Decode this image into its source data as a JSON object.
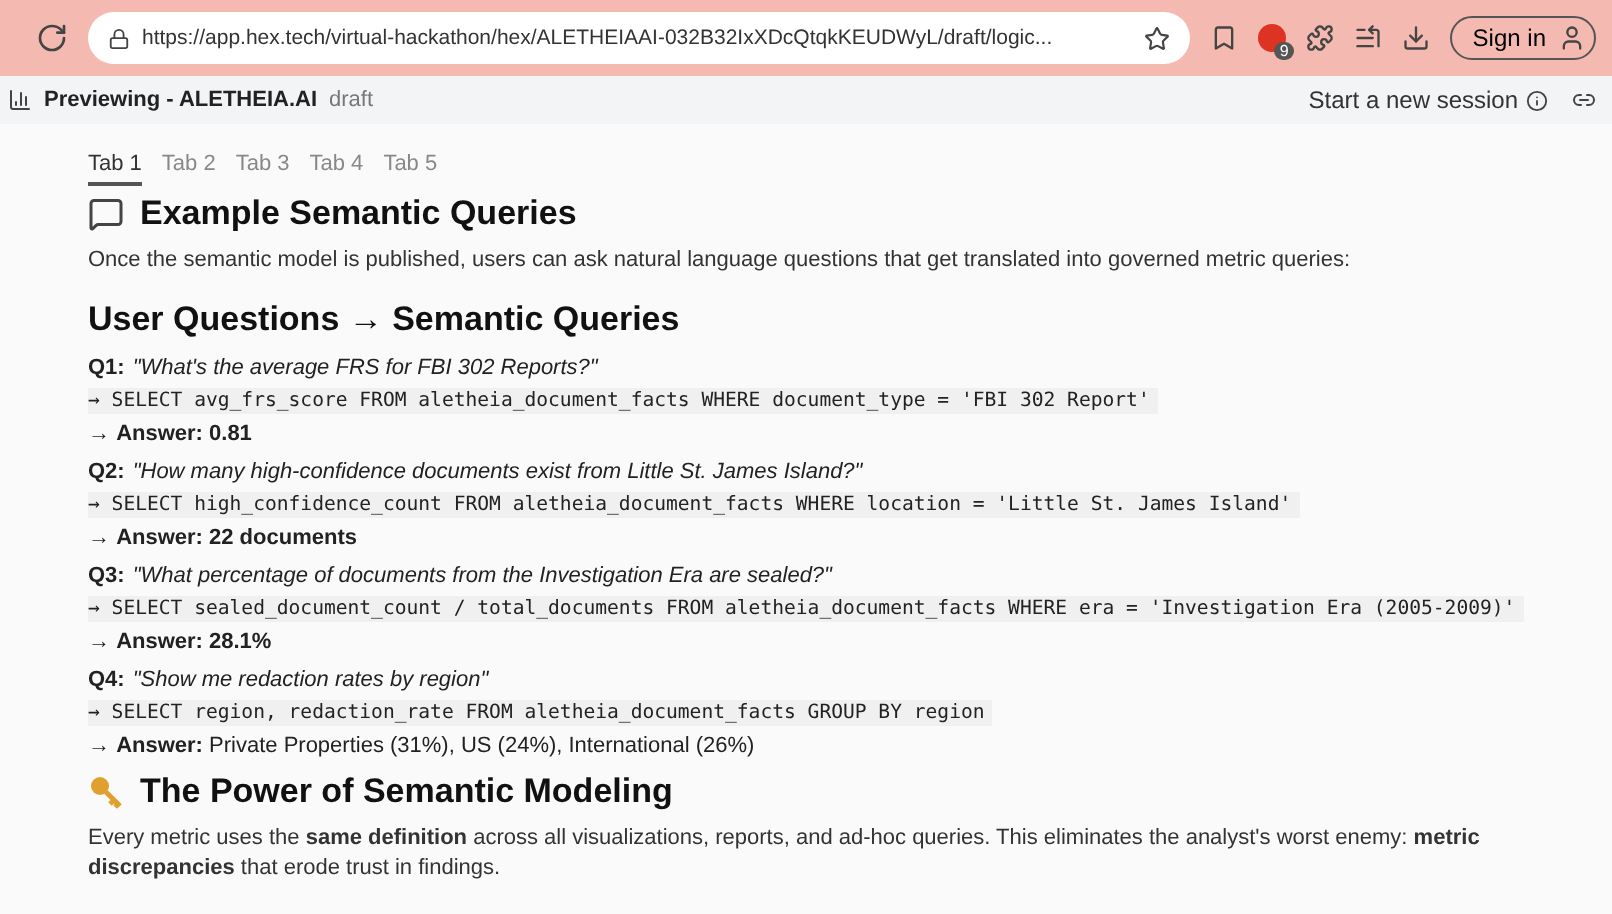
{
  "browser": {
    "url": "https://app.hex.tech/virtual-hackathon/hex/ALETHEIAAI-032B32IxXDcQtqkKEUDWyL/draft/logic...",
    "extension_badge": "9",
    "sign_in": "Sign in"
  },
  "app_header": {
    "title": "Previewing - ALETHEIA.AI",
    "status": "draft",
    "session_button": "Start a new session"
  },
  "tabs": [
    {
      "label": "Tab 1",
      "selected": true
    },
    {
      "label": "Tab 2",
      "selected": false
    },
    {
      "label": "Tab 3",
      "selected": false
    },
    {
      "label": "Tab 4",
      "selected": false
    },
    {
      "label": "Tab 5",
      "selected": false
    }
  ],
  "section": {
    "heading": "Example Semantic Queries",
    "intro": "Once the semantic model is published, users can ask natural language questions that get translated into governed metric queries:"
  },
  "subheading": "User Questions → Semantic Queries",
  "queries": [
    {
      "label": "Q1:",
      "question": "\"What's the average FRS for FBI 302 Reports?\"",
      "sql": "→ SELECT avg_frs_score FROM aletheia_document_facts WHERE document_type = 'FBI 302 Report'",
      "answer": "→ **Answer: 0.81**"
    },
    {
      "label": "Q2:",
      "question": "\"How many high-confidence documents exist from Little St. James Island?\"",
      "sql": "→ SELECT high_confidence_count FROM aletheia_document_facts WHERE location = 'Little St. James Island'",
      "answer": "→ **Answer: 22 documents**"
    },
    {
      "label": "Q3:",
      "question": "\"What percentage of documents from the Investigation Era are sealed?\"",
      "sql": "→ SELECT sealed_document_count / total_documents FROM aletheia_document_facts WHERE era = 'Investigation Era (2005-2009)'",
      "answer": "→ **Answer: 28.1%**"
    },
    {
      "label": "Q4:",
      "question": "\"Show me redaction rates by region\"",
      "sql": "→ SELECT region, redaction_rate FROM aletheia_document_facts GROUP BY region",
      "answer": "→ **Answer:** Private Properties (31%), US (24%), International (26%)"
    }
  ],
  "power": {
    "heading": "The Power of Semantic Modeling",
    "body": "Every metric uses the **same definition** across all visualizations, reports, and ad-hoc queries. This eliminates the analyst's worst enemy: **metric discrepancies** that erode trust in findings."
  }
}
